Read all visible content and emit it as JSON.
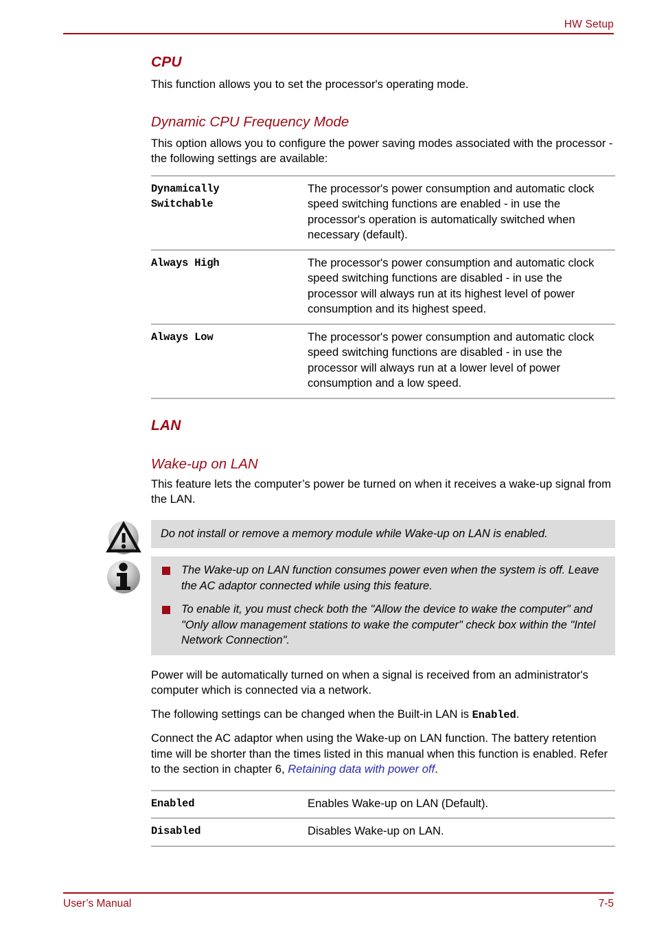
{
  "header": {
    "title": "HW Setup"
  },
  "sections": {
    "cpu": {
      "heading": "CPU",
      "intro": "This function allows you to set the processor's operating mode.",
      "subheading": "Dynamic CPU Frequency Mode",
      "sub_intro": "This option allows you to configure the power saving modes associated with the processor - the following settings are available:",
      "table": {
        "rows": [
          {
            "term_line1": "Dynamically",
            "term_line2": "Switchable",
            "description": "The processor's power consumption and automatic clock speed switching functions are enabled - in use the processor's operation is automatically switched when necessary (default)."
          },
          {
            "term_line1": "Always High",
            "term_line2": "",
            "description": "The processor's power consumption and automatic clock speed switching functions are disabled - in use the processor will always run at its highest level of power consumption and its highest speed."
          },
          {
            "term_line1": "Always Low",
            "term_line2": "",
            "description": "The processor's power consumption and automatic clock speed switching functions are disabled - in use the processor will always run at a lower level of power consumption and a low speed."
          }
        ]
      }
    },
    "lan": {
      "heading": "LAN",
      "subheading": "Wake-up on LAN",
      "intro": "This feature lets the computer’s power be turned on when it receives a wake-up signal from the LAN.",
      "caution": {
        "icon": "caution-triangle-icon",
        "text": "Do not install or remove a memory module while Wake-up on LAN is enabled."
      },
      "note": {
        "icon": "info-circle-icon",
        "bullets": [
          "The Wake-up on LAN function consumes power even when the system is off. Leave the AC adaptor connected while using this feature.",
          "To enable it, you must check both the \"Allow the device to wake the computer\" and \"Only allow management stations to wake the computer\" check box within the \"Intel Network Connection\"."
        ]
      },
      "para1": "Power will be automatically turned on when a signal is received from an administrator's computer which is connected via a network.",
      "para2_before": "The following settings can be changed when the Built-in LAN is ",
      "para2_mono": "Enabled",
      "para2_after": ".",
      "para3_before": "Connect the AC adaptor when using the Wake-up on LAN function. The battery retention time will be shorter than the times listed in this manual when this function is enabled. Refer to the section in chapter 6, ",
      "para3_link": "Retaining data with power off",
      "para3_after": ".",
      "table": {
        "rows": [
          {
            "term_line1": "Enabled",
            "term_line2": "",
            "description": "Enables Wake-up on LAN (Default)."
          },
          {
            "term_line1": "Disabled",
            "term_line2": "",
            "description": "Disables Wake-up on LAN."
          }
        ]
      }
    }
  },
  "footer": {
    "left": "User’s Manual",
    "right": "7-5"
  },
  "colors": {
    "accent_red": "#9c0b16",
    "bullet_red": "#9c0b16",
    "callout_bg": "#dcdcdc",
    "rule_gray": "#b3b3b3",
    "link_blue": "#2a2ab0"
  }
}
